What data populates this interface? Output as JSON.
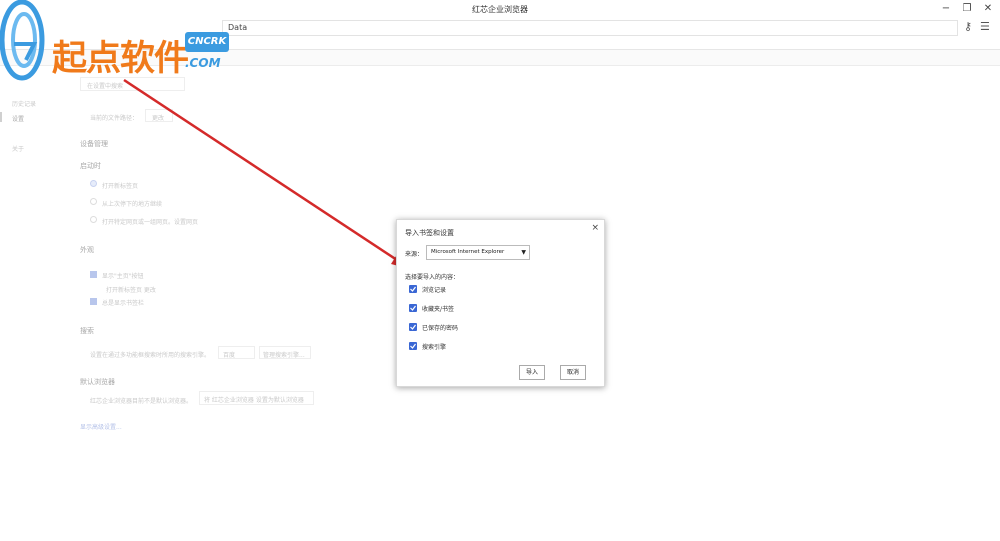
{
  "window": {
    "title": "红芯企业浏览器"
  },
  "window_controls": {
    "minimize": "−",
    "restore": "❐",
    "close": "✕"
  },
  "address_bar": {
    "value": "Data"
  },
  "toolbar_icons": {
    "key": "⚷",
    "menu": "☰"
  },
  "watermark": {
    "text": "起点软件",
    "badge": "CNCRK",
    "suffix": ".COM"
  },
  "background_page": {
    "sidebar": [
      "历史记录",
      "设置",
      "关于"
    ],
    "search_placeholder": "在设置中搜索",
    "sections": {
      "downloads_label": "当前的文件路径：",
      "downloads_button": "更改",
      "devices": "设备管理",
      "startup": "启动时",
      "startup_options": [
        "打开新标签页",
        "从上次停下的地方继续",
        "打开特定网页或一组网页。设置网页"
      ],
      "appearance": "外观",
      "appearance_options": [
        "显示\"主页\"按钮",
        "打开新标签页 更改",
        "总是显示书签栏"
      ],
      "search": "搜索",
      "search_desc": "设置在通过多功能框搜索时所用的搜索引擎。",
      "search_engine": "百度",
      "search_manage": "管理搜索引擎...",
      "default_browser": "默认浏览器",
      "default_browser_desc": "红芯企业浏览器目前不是默认浏览器。",
      "default_browser_button": "将 红芯企业浏览器 设置为默认浏览器",
      "advanced": "显示高级设置..."
    }
  },
  "dialog": {
    "title": "导入书签和设置",
    "close": "×",
    "source_label": "来源：",
    "source_value": "Microsoft Internet Explorer",
    "choose_label": "选择要导入的内容：",
    "options": [
      {
        "label": "浏览记录",
        "checked": true
      },
      {
        "label": "收藏夹/书签",
        "checked": true
      },
      {
        "label": "已保存的密码",
        "checked": true
      },
      {
        "label": "搜索引擎",
        "checked": true
      }
    ],
    "import_button": "导入",
    "cancel_button": "取消"
  },
  "colors": {
    "accent": "#3a67d4",
    "arrow": "#d42a2a",
    "logo_orange": "#f07a1a",
    "logo_blue": "#3b9be0"
  }
}
